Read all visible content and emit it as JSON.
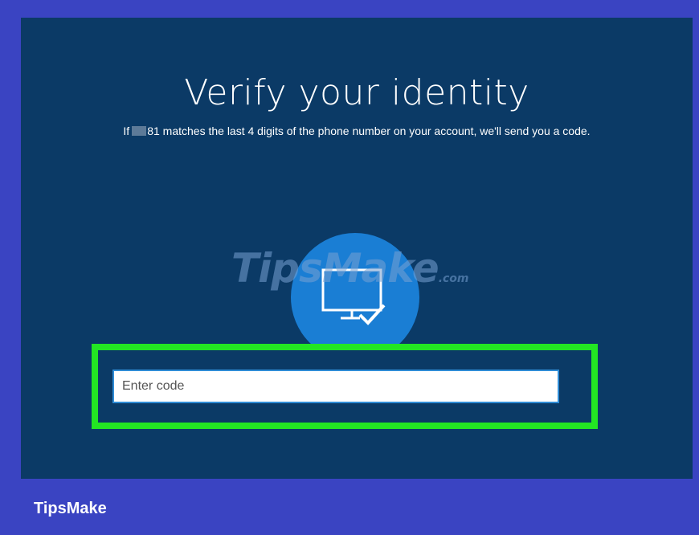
{
  "screen": {
    "title": "Verify your identity",
    "subtitle_prefix": "If",
    "subtitle_suffix": "81 matches the last 4 digits of the phone number on your account, we'll send you a code.",
    "illustration_icon": "monitor-check-icon",
    "code_input": {
      "placeholder": "Enter code",
      "value": ""
    }
  },
  "watermark": {
    "text": "TipsMake",
    "suffix": ".com"
  },
  "footer": {
    "brand": "TipsMake"
  },
  "colors": {
    "background": "#3a44c2",
    "screen": "#0b3a66",
    "circle": "#1a7ed4",
    "highlight": "#23e623"
  }
}
